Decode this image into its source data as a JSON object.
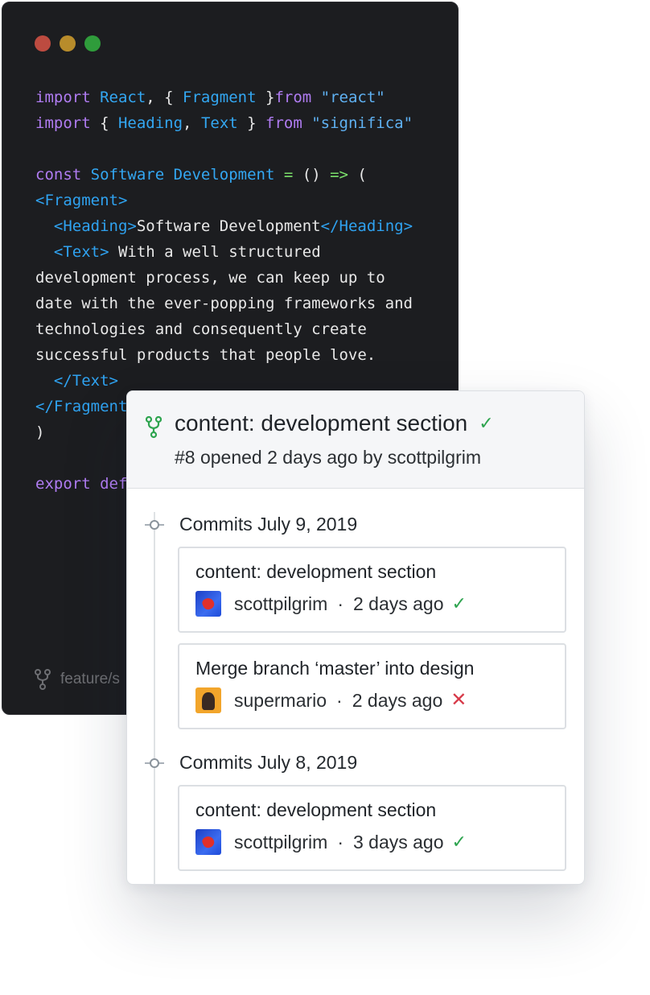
{
  "editor": {
    "code_lines": [
      [
        {
          "t": "import ",
          "c": "kw"
        },
        {
          "t": "React",
          "c": "id"
        },
        {
          "t": ", { ",
          "c": ""
        },
        {
          "t": "Fragment",
          "c": "id"
        },
        {
          "t": " }",
          "c": ""
        },
        {
          "t": "from ",
          "c": "kw"
        },
        {
          "t": "\"react\"",
          "c": "str"
        }
      ],
      [
        {
          "t": "import ",
          "c": "kw"
        },
        {
          "t": "{ ",
          "c": ""
        },
        {
          "t": "Heading",
          "c": "id"
        },
        {
          "t": ", ",
          "c": ""
        },
        {
          "t": "Text",
          "c": "id"
        },
        {
          "t": " } ",
          "c": ""
        },
        {
          "t": "from ",
          "c": "kw"
        },
        {
          "t": "\"significa\"",
          "c": "str"
        }
      ],
      [],
      [
        {
          "t": "const ",
          "c": "kw"
        },
        {
          "t": "Software Development",
          "c": "id"
        },
        {
          "t": " = ",
          "c": "op"
        },
        {
          "t": "() ",
          "c": ""
        },
        {
          "t": "=>",
          "c": "op"
        },
        {
          "t": " (",
          "c": ""
        }
      ],
      [
        {
          "t": "<Fragment>",
          "c": "tag"
        }
      ],
      [
        {
          "t": "  ",
          "c": ""
        },
        {
          "t": "<Heading>",
          "c": "tag"
        },
        {
          "t": "Software Development",
          "c": ""
        },
        {
          "t": "</Heading>",
          "c": "tag"
        }
      ],
      [
        {
          "t": "  ",
          "c": ""
        },
        {
          "t": "<Text>",
          "c": "tag"
        },
        {
          "t": " With a well structured",
          "c": ""
        }
      ],
      [
        {
          "t": "development process, we can keep up to",
          "c": ""
        }
      ],
      [
        {
          "t": "date with the ever-popping frameworks and",
          "c": ""
        }
      ],
      [
        {
          "t": "technologies and consequently create",
          "c": ""
        }
      ],
      [
        {
          "t": "successful products that people love.",
          "c": ""
        }
      ],
      [
        {
          "t": "  ",
          "c": ""
        },
        {
          "t": "</Text>",
          "c": "tag"
        }
      ],
      [
        {
          "t": "</Fragment>",
          "c": "tag"
        }
      ],
      [
        {
          "t": ")",
          "c": ""
        }
      ],
      [],
      [
        {
          "t": "export def",
          "c": "kw"
        }
      ]
    ],
    "branch_label": "feature/s"
  },
  "pull_request": {
    "title": "content: development section",
    "subtitle": "#8 opened 2 days ago by scottpilgrim",
    "status": "success"
  },
  "commit_groups": [
    {
      "label": "Commits July 9, 2019",
      "commits": [
        {
          "title": "content: development section",
          "author": "scottpilgrim",
          "avatar": "scott",
          "separator": "·",
          "time": "2 days ago",
          "status": "success"
        },
        {
          "title": "Merge branch ‘master’ into design",
          "author": "supermario",
          "avatar": "mario",
          "separator": "·",
          "time": "2 days ago",
          "status": "failure"
        }
      ]
    },
    {
      "label": "Commits July 8, 2019",
      "commits": [
        {
          "title": "content: development section",
          "author": "scottpilgrim",
          "avatar": "scott",
          "separator": "·",
          "time": "3 days ago",
          "status": "success"
        }
      ]
    }
  ],
  "colors": {
    "success": "#2ea44f",
    "failure": "#d73a49",
    "keyword": "#b07cf2",
    "identifier": "#33a7f2"
  },
  "icons": {
    "check": "✓",
    "cross": "✕"
  }
}
